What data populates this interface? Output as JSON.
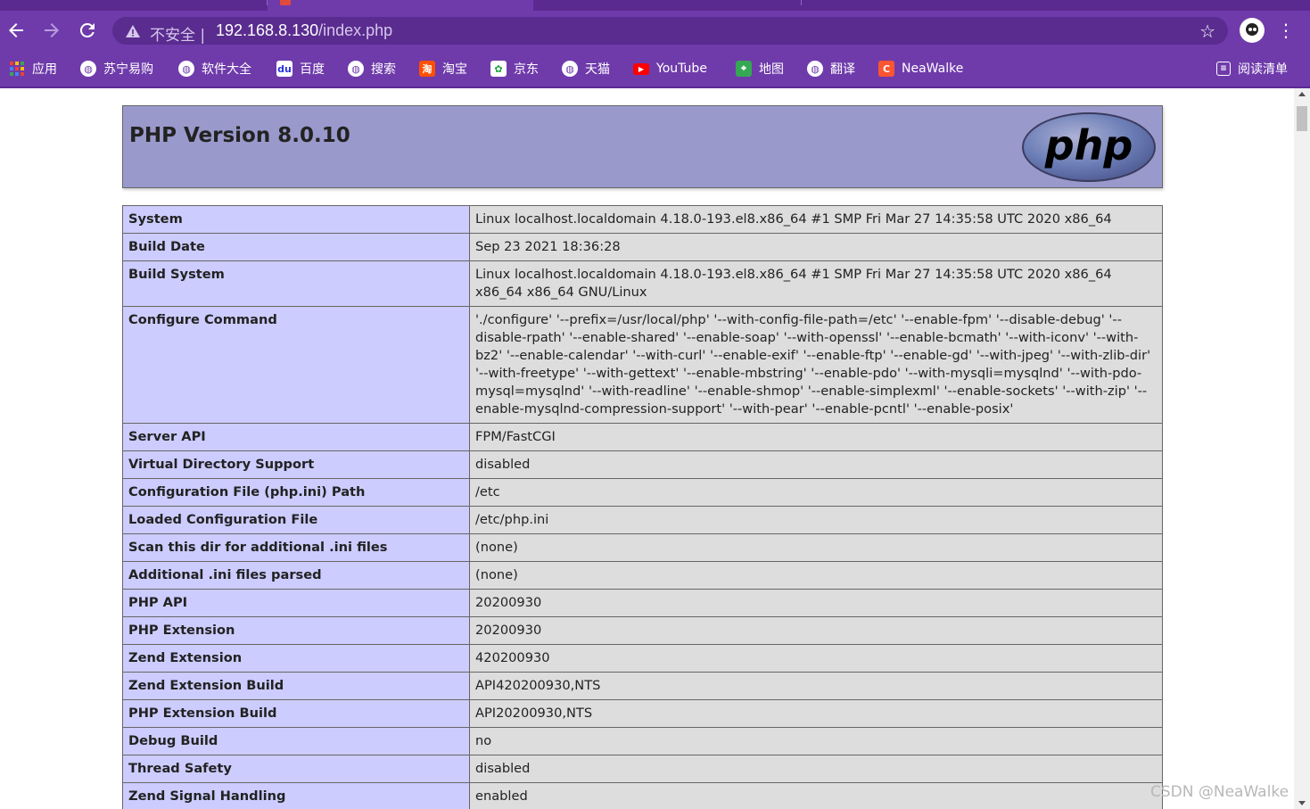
{
  "browser": {
    "security_label": "不安全",
    "separator": "|",
    "url_host": "192.168.8.130",
    "url_path": "/index.php",
    "bookmarks": [
      {
        "label": "应用",
        "icon": "apps-grid-icon"
      },
      {
        "label": "苏宁易购",
        "icon": "globe-icon"
      },
      {
        "label": "软件大全",
        "icon": "globe-icon"
      },
      {
        "label": "百度",
        "icon": "baidu-icon"
      },
      {
        "label": "搜索",
        "icon": "globe-icon"
      },
      {
        "label": "淘宝",
        "icon": "taobao-icon"
      },
      {
        "label": "京东",
        "icon": "jd-icon"
      },
      {
        "label": "天猫",
        "icon": "globe-icon"
      },
      {
        "label": "YouTube",
        "icon": "youtube-icon"
      },
      {
        "label": "地图",
        "icon": "maps-icon"
      },
      {
        "label": "翻译",
        "icon": "globe-icon"
      },
      {
        "label": "NeaWalke",
        "icon": "csdn-icon"
      }
    ],
    "reading_list": "阅读清单"
  },
  "page": {
    "title": "PHP Version 8.0.10",
    "logo_text": "php",
    "rows": [
      {
        "key": "System",
        "value": "Linux localhost.localdomain 4.18.0-193.el8.x86_64 #1 SMP Fri Mar 27 14:35:58 UTC 2020 x86_64"
      },
      {
        "key": "Build Date",
        "value": "Sep 23 2021 18:36:28"
      },
      {
        "key": "Build System",
        "value": "Linux localhost.localdomain 4.18.0-193.el8.x86_64 #1 SMP Fri Mar 27 14:35:58 UTC 2020 x86_64 x86_64 x86_64 GNU/Linux"
      },
      {
        "key": "Configure Command",
        "value": "'./configure' '--prefix=/usr/local/php' '--with-config-file-path=/etc' '--enable-fpm' '--disable-debug' '--disable-rpath' '--enable-shared' '--enable-soap' '--with-openssl' '--enable-bcmath' '--with-iconv' '--with-bz2' '--enable-calendar' '--with-curl' '--enable-exif' '--enable-ftp' '--enable-gd' '--with-jpeg' '--with-zlib-dir' '--with-freetype' '--with-gettext' '--enable-mbstring' '--enable-pdo' '--with-mysqli=mysqlnd' '--with-pdo-mysql=mysqlnd' '--with-readline' '--enable-shmop' '--enable-simplexml' '--enable-sockets' '--with-zip' '--enable-mysqlnd-compression-support' '--with-pear' '--enable-pcntl' '--enable-posix'"
      },
      {
        "key": "Server API",
        "value": "FPM/FastCGI"
      },
      {
        "key": "Virtual Directory Support",
        "value": "disabled"
      },
      {
        "key": "Configuration File (php.ini) Path",
        "value": "/etc"
      },
      {
        "key": "Loaded Configuration File",
        "value": "/etc/php.ini"
      },
      {
        "key": "Scan this dir for additional .ini files",
        "value": "(none)"
      },
      {
        "key": "Additional .ini files parsed",
        "value": "(none)"
      },
      {
        "key": "PHP API",
        "value": "20200930"
      },
      {
        "key": "PHP Extension",
        "value": "20200930"
      },
      {
        "key": "Zend Extension",
        "value": "420200930"
      },
      {
        "key": "Zend Extension Build",
        "value": "API420200930,NTS"
      },
      {
        "key": "PHP Extension Build",
        "value": "API20200930,NTS"
      },
      {
        "key": "Debug Build",
        "value": "no"
      },
      {
        "key": "Thread Safety",
        "value": "disabled"
      },
      {
        "key": "Zend Signal Handling",
        "value": "enabled"
      }
    ]
  },
  "watermark": "CSDN @NeaWalke",
  "colors": {
    "chrome": "#6f3bab",
    "header_bg": "#9999cc",
    "key_bg": "#ccccff",
    "value_bg": "#dddddd"
  }
}
